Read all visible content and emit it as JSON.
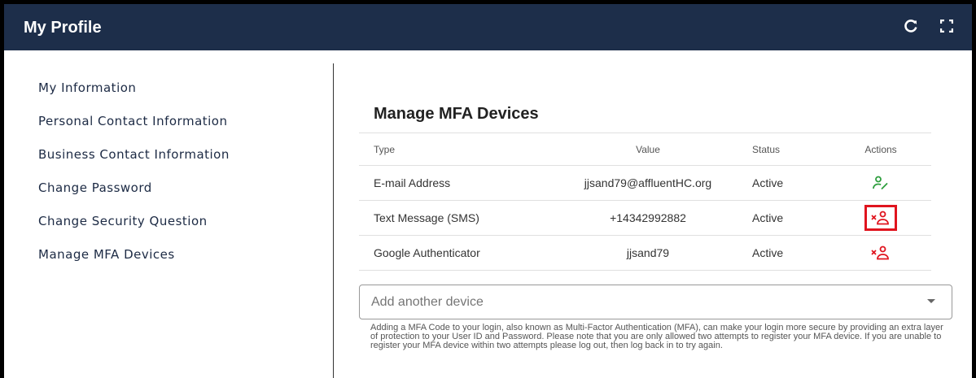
{
  "header": {
    "title": "My Profile",
    "icons": [
      "refresh-icon",
      "fullscreen-icon"
    ]
  },
  "sidebar": {
    "items": [
      {
        "label": "My Information"
      },
      {
        "label": "Personal Contact Information"
      },
      {
        "label": "Business Contact Information"
      },
      {
        "label": "Change Password"
      },
      {
        "label": "Change Security Question"
      },
      {
        "label": "Manage MFA Devices"
      }
    ]
  },
  "main": {
    "title": "Manage MFA Devices",
    "columns": {
      "type": "Type",
      "value": "Value",
      "status": "Status",
      "actions": "Actions"
    },
    "rows": [
      {
        "type": "E-mail Address",
        "value": "jjsand79@affluentHC.org",
        "status": "Active",
        "action_icon": "edit-user-icon"
      },
      {
        "type": "Text Message (SMS)",
        "value": "+14342992882",
        "status": "Active",
        "action_icon": "remove-user-icon"
      },
      {
        "type": "Google Authenticator",
        "value": "jjsand79",
        "status": "Active",
        "action_icon": "remove-user-icon"
      }
    ],
    "add_device": {
      "placeholder": "Add another device"
    },
    "help_text": "Adding a MFA Code to your login, also known as Multi-Factor Authentication (MFA), can make your login more secure by providing an extra layer of protection to your User ID and Password. Please note that you are only allowed two attempts to register your MFA device. If you are unable to register your MFA device within two attempts please log out, then log back in to try again."
  },
  "colors": {
    "header_bg": "#1d2e4a",
    "edit_icon": "#2e9e3e",
    "remove_icon": "#e0141e",
    "highlight": "#e0141e"
  }
}
